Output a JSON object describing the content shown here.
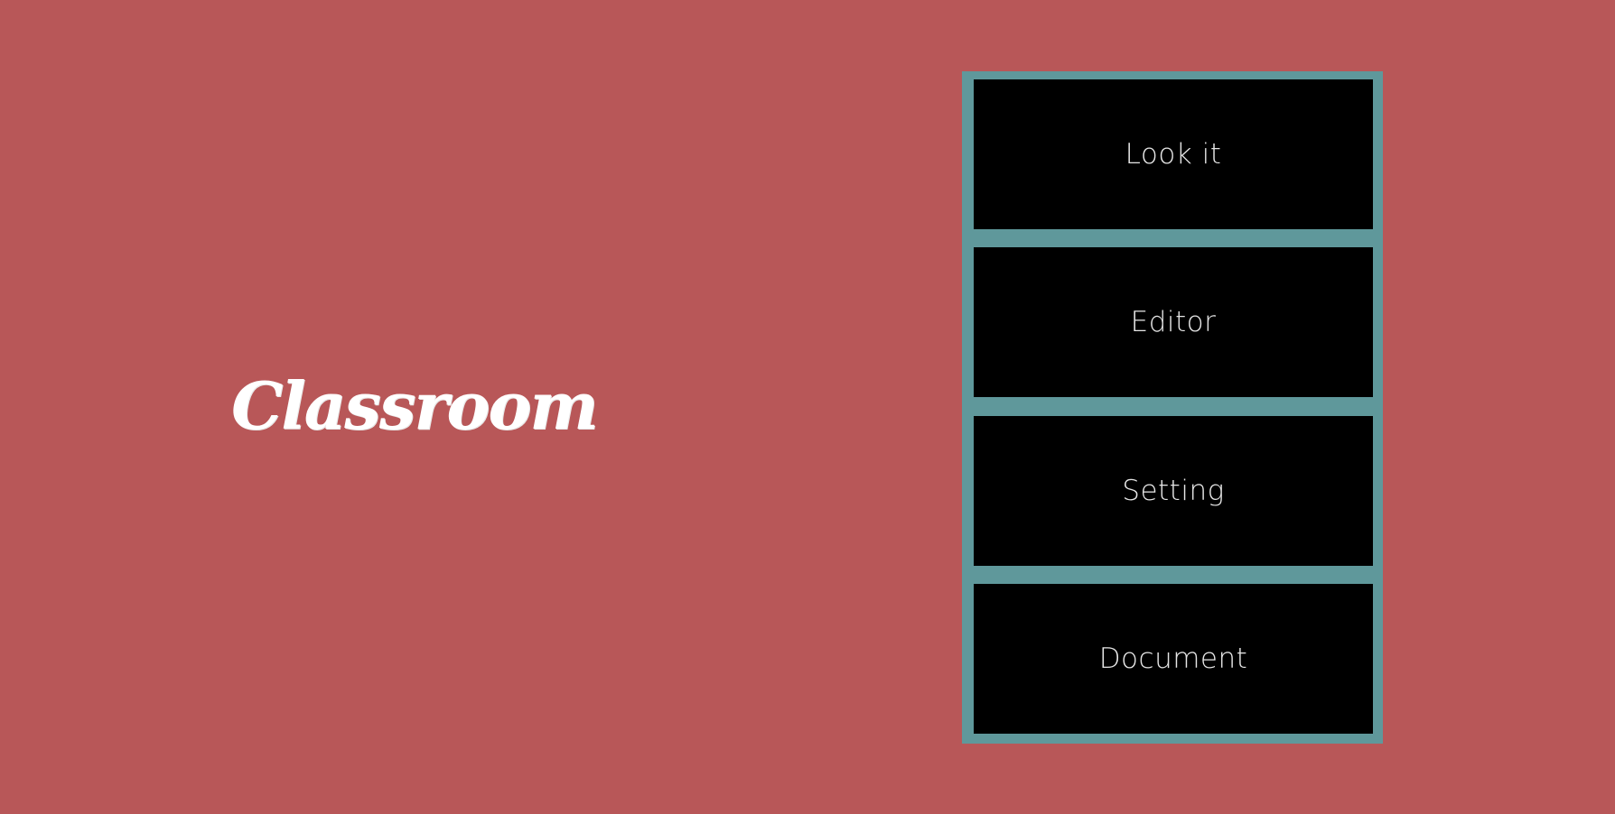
{
  "colors": {
    "background": "#b85758",
    "panel": "#5f989b",
    "button": "#000000",
    "button_text": "#e6e6e6",
    "logo_text": "#ffffff"
  },
  "logo": {
    "text": "Classroom"
  },
  "menu": {
    "items": [
      {
        "label": "Look it"
      },
      {
        "label": "Editor"
      },
      {
        "label": "Setting"
      },
      {
        "label": "Document"
      }
    ]
  }
}
